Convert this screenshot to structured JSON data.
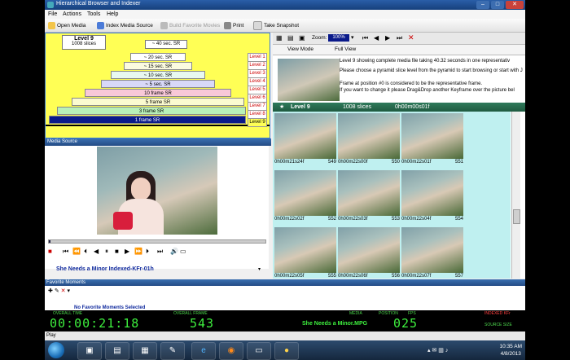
{
  "window": {
    "title": "Hierarchical Browser and Indexer"
  },
  "menu": [
    "File",
    "Actions",
    "Tools",
    "Help"
  ],
  "toolbar": {
    "open": "Open Media",
    "index": "Index Media Source",
    "fav": "Build Favorite Movies",
    "print": "Print",
    "snapshot": "Take Snapshot"
  },
  "pyramid": {
    "level_name": "Level 9",
    "slices": "1008 slices",
    "badge": "~ 40 sec. SR",
    "bars": [
      "~ 20 sec. SR",
      "~ 15 sec. SR",
      "~ 10 sec. SR",
      "~ 5 sec. SR",
      "10 frame SR",
      "5 frame SR",
      "3 frame SR",
      "1 frame SR"
    ],
    "levels": [
      "Level 1",
      "Level 2",
      "Level 3",
      "Level 4",
      "Level 5",
      "Level 6",
      "Level 7",
      "Level 8",
      "Level 9"
    ]
  },
  "media_source": {
    "caption": "Media Source",
    "title": "She Needs a Minor Indexed-KFr-01h"
  },
  "right": {
    "zoom_label": "Zoom:",
    "zoom_value": "100%",
    "tab_view": "View Mode",
    "tab_full": "Full View",
    "info1": "Level 9 showing complete media file taking 40.32 seconds in one representativ",
    "info2": "Please choose a pyramid slice level from the pyramid to start browsing or start with J",
    "info3": "Frame at position #0 is considered to be the representative frame.",
    "info4": "If you want to change it please Drag&Drop another Keyframe over the picture bel",
    "level": "Level 9",
    "slices": "1008 slices",
    "time": "0h00m00s01f"
  },
  "thumbs": [
    {
      "label": "0h00m21s24f",
      "num": "549"
    },
    {
      "label": "0h00m22s00f",
      "num": "550"
    },
    {
      "label": "0h00m22s01f",
      "num": "551"
    },
    {
      "label": "0h00m22s02f",
      "num": "552"
    },
    {
      "label": "0h00m22s03f",
      "num": "553"
    },
    {
      "label": "0h00m22s04f",
      "num": "554"
    },
    {
      "label": "0h00m22s05f",
      "num": "555"
    },
    {
      "label": "0h00m22s06f",
      "num": "556"
    },
    {
      "label": "0h00m22s07f",
      "num": "557"
    }
  ],
  "favorites": {
    "caption": "Favorite Moments",
    "message": "No Favorite Moments Selected"
  },
  "status": {
    "lbl_overall": "OVERALL TIME",
    "lbl_frame": "OVERALL FRAME",
    "lbl_media": "MEDIA",
    "lbl_pos": "POSITION",
    "lbl_fps": "FPS",
    "lbl_indexed": "INDEXED KFr",
    "lbl_source": "SOURCE SIZE",
    "time": "00:00:21:18",
    "frame": "543",
    "media": "She Needs a Minor.MPG",
    "fps": "025",
    "play": "Play"
  },
  "taskbar": {
    "time": "10:35 AM",
    "date": "4/8/2013"
  }
}
